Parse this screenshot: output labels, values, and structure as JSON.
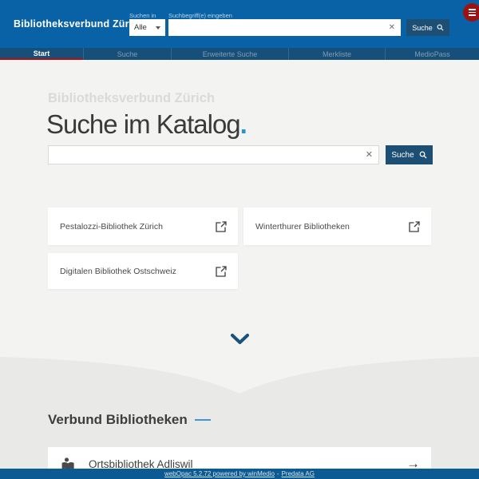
{
  "header": {
    "logo": "Bibliotheksverbund Zürich",
    "search_in_label": "Suchen in",
    "search_in_value": "Alle",
    "term_label": "Suchbegriff(e) eingeben",
    "input_value": "",
    "clear_icon": "✕",
    "search_button_label": "Suche"
  },
  "nav": {
    "items": [
      {
        "label": "Start",
        "active": true
      },
      {
        "label": "Suche",
        "active": false
      },
      {
        "label": "Erweiterte Suche",
        "active": false
      },
      {
        "label": "Merkliste",
        "active": false
      },
      {
        "label": "MedioPass",
        "active": false
      }
    ]
  },
  "hero": {
    "subtitle": "Bibliotheksverbund Zürich",
    "title": "Suche im Katalog",
    "dot": ".",
    "input_value": "",
    "clear_icon": "✕",
    "search_button_label": "Suche"
  },
  "external_links": [
    {
      "label": "Pestalozzi-Bibliothek Zürich"
    },
    {
      "label": "Winterthurer Bibliotheken"
    },
    {
      "label": "Digitalen Bibliothek Ostschweiz"
    }
  ],
  "verbund": {
    "heading": "Verbund Bibliotheken",
    "libraries": [
      {
        "label": "Ortsbibliothek Adliswil",
        "arrow": "→"
      }
    ]
  },
  "footer": {
    "link_app": "webOpac 5.2.72 powered by winMedio",
    "separator": "-",
    "link_company": "Predata AG"
  },
  "colors": {
    "header_blue": "#0862a5",
    "nav_blue": "#174f7b",
    "tab_underline_red": "#b11111",
    "menu_button_red": "#9c1313",
    "button_navy": "#1d4e74",
    "accent_blue": "#2196d3",
    "section_light": "#f3f3f1",
    "section_dark": "#e9e9e7",
    "footer_blue": "#0c5a94"
  }
}
